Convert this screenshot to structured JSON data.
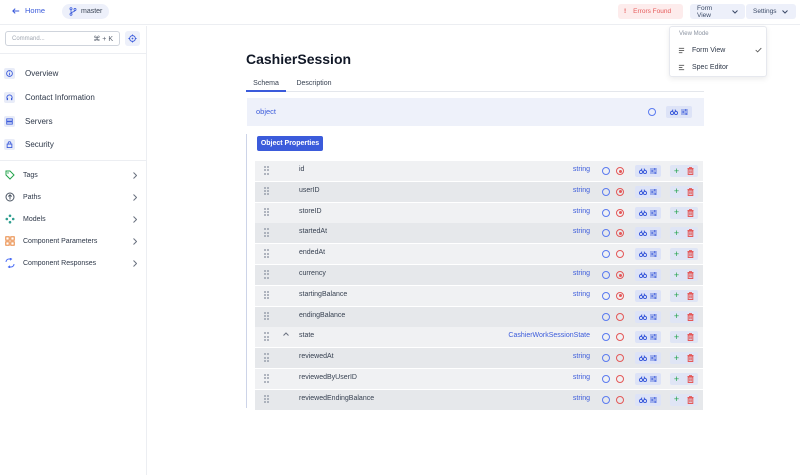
{
  "topbar": {
    "home_label": "Home",
    "branch_label": "master",
    "errors_label": "Errors Found",
    "view_label": "Form View",
    "settings_label": "Settings"
  },
  "view_menu": {
    "header": "View Mode",
    "items": [
      {
        "label": "Form View",
        "checked": true,
        "icon": "form-view-icon"
      },
      {
        "label": "Spec Editor",
        "checked": false,
        "icon": "spec-editor-icon"
      }
    ]
  },
  "sidebar": {
    "command_placeholder": "Command...",
    "command_shortcut": "⌘ + K",
    "primary": [
      {
        "label": "Overview",
        "icon": "info-icon"
      },
      {
        "label": "Contact Information",
        "icon": "headset-icon"
      },
      {
        "label": "Servers",
        "icon": "server-icon"
      },
      {
        "label": "Security",
        "icon": "lock-icon"
      }
    ],
    "secondary": [
      {
        "label": "Tags",
        "icon": "tag-icon"
      },
      {
        "label": "Paths",
        "icon": "paths-icon"
      },
      {
        "label": "Models",
        "icon": "models-icon"
      },
      {
        "label": "Component Parameters",
        "icon": "parameters-icon"
      },
      {
        "label": "Component Responses",
        "icon": "responses-icon"
      }
    ]
  },
  "main": {
    "title": "CashierSession",
    "tabs": [
      {
        "label": "Schema",
        "active": true
      },
      {
        "label": "Description",
        "active": false
      }
    ],
    "root_type": "object",
    "properties_label": "Object Properties",
    "properties": [
      {
        "name": "id",
        "type": "string",
        "required": true,
        "expandable": false
      },
      {
        "name": "userID",
        "type": "string",
        "required": true,
        "expandable": false
      },
      {
        "name": "storeID",
        "type": "string",
        "required": true,
        "expandable": false
      },
      {
        "name": "startedAt",
        "type": "string",
        "required": true,
        "expandable": false
      },
      {
        "name": "endedAt",
        "type": "",
        "required": false,
        "expandable": false
      },
      {
        "name": "currency",
        "type": "string",
        "required": true,
        "expandable": false
      },
      {
        "name": "startingBalance",
        "type": "string",
        "required": true,
        "expandable": false
      },
      {
        "name": "endingBalance",
        "type": "",
        "required": false,
        "expandable": false
      },
      {
        "name": "state",
        "type": "CashierWorkSessionState",
        "required": false,
        "expandable": true
      },
      {
        "name": "reviewedAt",
        "type": "string",
        "required": false,
        "expandable": false
      },
      {
        "name": "reviewedByUserID",
        "type": "string",
        "required": false,
        "expandable": false
      },
      {
        "name": "reviewedEndingBalance",
        "type": "string",
        "required": false,
        "expandable": false
      }
    ]
  },
  "colors": {
    "accent": "#3b5bdb",
    "error": "#e45858",
    "success": "#22a34a"
  }
}
